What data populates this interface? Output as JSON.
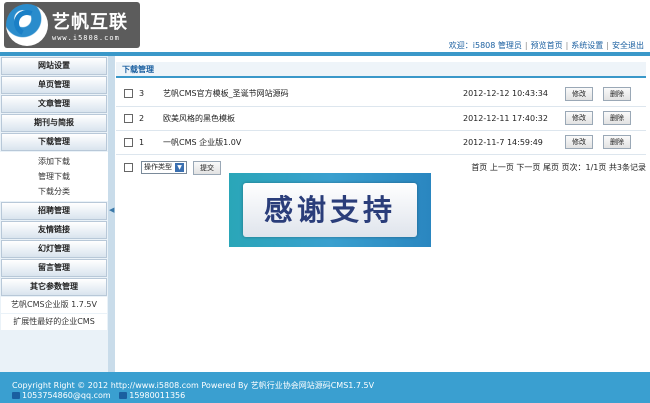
{
  "header": {
    "logo_text": "艺帆互联",
    "logo_url": "www.i5808.com",
    "welcome": "欢迎：",
    "user": "i5808 管理员",
    "nav": [
      "预览首页",
      "系统设置",
      "安全退出"
    ]
  },
  "sidebar": {
    "menus_top": [
      "网站设置",
      "单页管理",
      "文章管理",
      "期刊与简报",
      "下载管理"
    ],
    "sub_items": [
      "添加下载",
      "管理下载",
      "下载分类"
    ],
    "menus_bottom": [
      "招聘管理",
      "友情链接",
      "幻灯管理",
      "留言管理",
      "其它参数管理"
    ],
    "extra_items": [
      "艺帆CMS企业版 1.7.5V",
      "扩展性最好的企业CMS"
    ]
  },
  "main": {
    "section_title": "下载管理",
    "rows": [
      {
        "id": "3",
        "title": "艺帆CMS官方模板_圣诞节网站源码",
        "date": "2012-12-12 10:43:34"
      },
      {
        "id": "2",
        "title": "欧美风格的黑色模板",
        "date": "2012-12-11 17:40:32"
      },
      {
        "id": "1",
        "title": "一帆CMS 企业版1.0V",
        "date": "2012-11-7 14:59:49"
      }
    ],
    "edit_label": "修改",
    "delete_label": "删除",
    "action_select": "操作类型",
    "submit_label": "提交",
    "pager": "首页 上一页 下一页 尾页 页次：1/1页 共3条记录"
  },
  "banner": {
    "text": "感谢支持"
  },
  "footer": {
    "line1": "Copyright Right © 2012 http://www.i5808.com Powered By 艺帆行业协会网站源码CMS1.7.5V",
    "qq": "1053754860@qq.com",
    "phone": "15980011356"
  },
  "colors": {
    "accent": "#3a98c9",
    "footer": "#3a9fd0",
    "link": "#1a5fa0"
  }
}
